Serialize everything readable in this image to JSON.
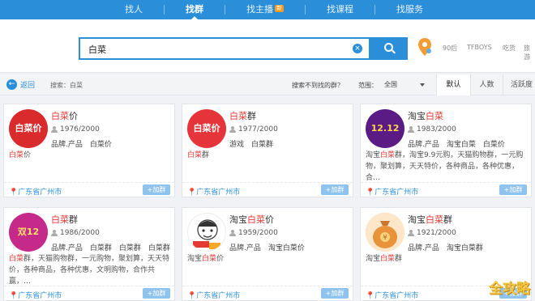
{
  "nav": {
    "tabs": [
      {
        "label": "找人",
        "active": false
      },
      {
        "label": "找群",
        "active": true
      },
      {
        "label": "找主播",
        "active": false,
        "badge": "新"
      },
      {
        "label": "找课程",
        "active": false
      },
      {
        "label": "找服务",
        "active": false
      }
    ]
  },
  "search": {
    "value": "白菜",
    "clear_icon": "clear-icon",
    "hot": [
      "90后",
      "TFBOYS",
      "吃货",
      "旅游"
    ]
  },
  "filter": {
    "back_label": "返回",
    "query_prefix": "搜索：白菜",
    "not_found": "搜索不到找的群？",
    "range_label": "范围：",
    "range_value": "全国",
    "sorts": [
      "默认",
      "人数",
      "活跃度"
    ]
  },
  "cards": [
    {
      "title_hl": "白菜",
      "title_rest": "价",
      "members": "1976/2000",
      "tags": [
        "品牌.产品",
        "白菜价"
      ],
      "desc_hl": "白菜",
      "desc_rest": "价",
      "location": "广东省广州市",
      "join": "+加群",
      "avatar_text": "白菜价"
    },
    {
      "title_hl": "白菜",
      "title_rest": "群",
      "members": "1977/2000",
      "tags": [
        "游戏",
        "白菜群"
      ],
      "desc_hl": "白菜",
      "desc_rest": "群",
      "location": "广东省广州市",
      "join": "+加群",
      "avatar_text": "白菜价"
    },
    {
      "title_pre": "淘宝",
      "title_hl": "白菜",
      "title_rest": "",
      "members": "1983/2000",
      "tags": [
        "品牌.产品",
        "淘宝白菜",
        "白菜价"
      ],
      "desc_pre": "淘宝",
      "desc_hl": "白菜",
      "desc_rest": "群，淘宝9.9元购，天猫购物群，一元购物，聚划算，天天特价，各种商品，各种优惠，合…",
      "location": "广东省广州市",
      "join": "+加群",
      "avatar_text": "12.12"
    },
    {
      "title_hl": "白菜",
      "title_rest": "群",
      "members": "1986/2000",
      "tags": [
        "品牌.产品",
        "白菜群",
        "白菜群",
        "白菜群"
      ],
      "desc_hl": "白菜",
      "desc_rest": "群，天猫购物群，一元购物，聚划算，天天特价，各种商品，各种优惠，文明购物，合作共赢，…",
      "location": "广东省广州市",
      "join": "+加群",
      "avatar_text": "双12"
    },
    {
      "title_pre": "淘宝",
      "title_hl": "白菜",
      "title_rest": "价",
      "members": "1959/2000",
      "tags": [
        "品牌.产品",
        "淘宝白菜价"
      ],
      "desc_pre": "淘宝",
      "desc_hl": "白菜",
      "desc_rest": "价",
      "location": "广东省广州市",
      "join": "+加群",
      "avatar_text": ""
    },
    {
      "title_pre": "淘宝",
      "title_hl": "白菜",
      "title_rest": "群",
      "members": "1921/2000",
      "tags": [
        "品牌.产品",
        "淘宝白菜群"
      ],
      "desc_pre": "淘宝",
      "desc_hl": "白菜",
      "desc_rest": "群",
      "location": "广东省广州市",
      "join": "+加群",
      "avatar_text": ""
    }
  ],
  "watermark": "全攻略",
  "colors": {
    "accent": "#2a8fd8",
    "highlight": "#e53935",
    "badge": "#ff9a1a"
  }
}
